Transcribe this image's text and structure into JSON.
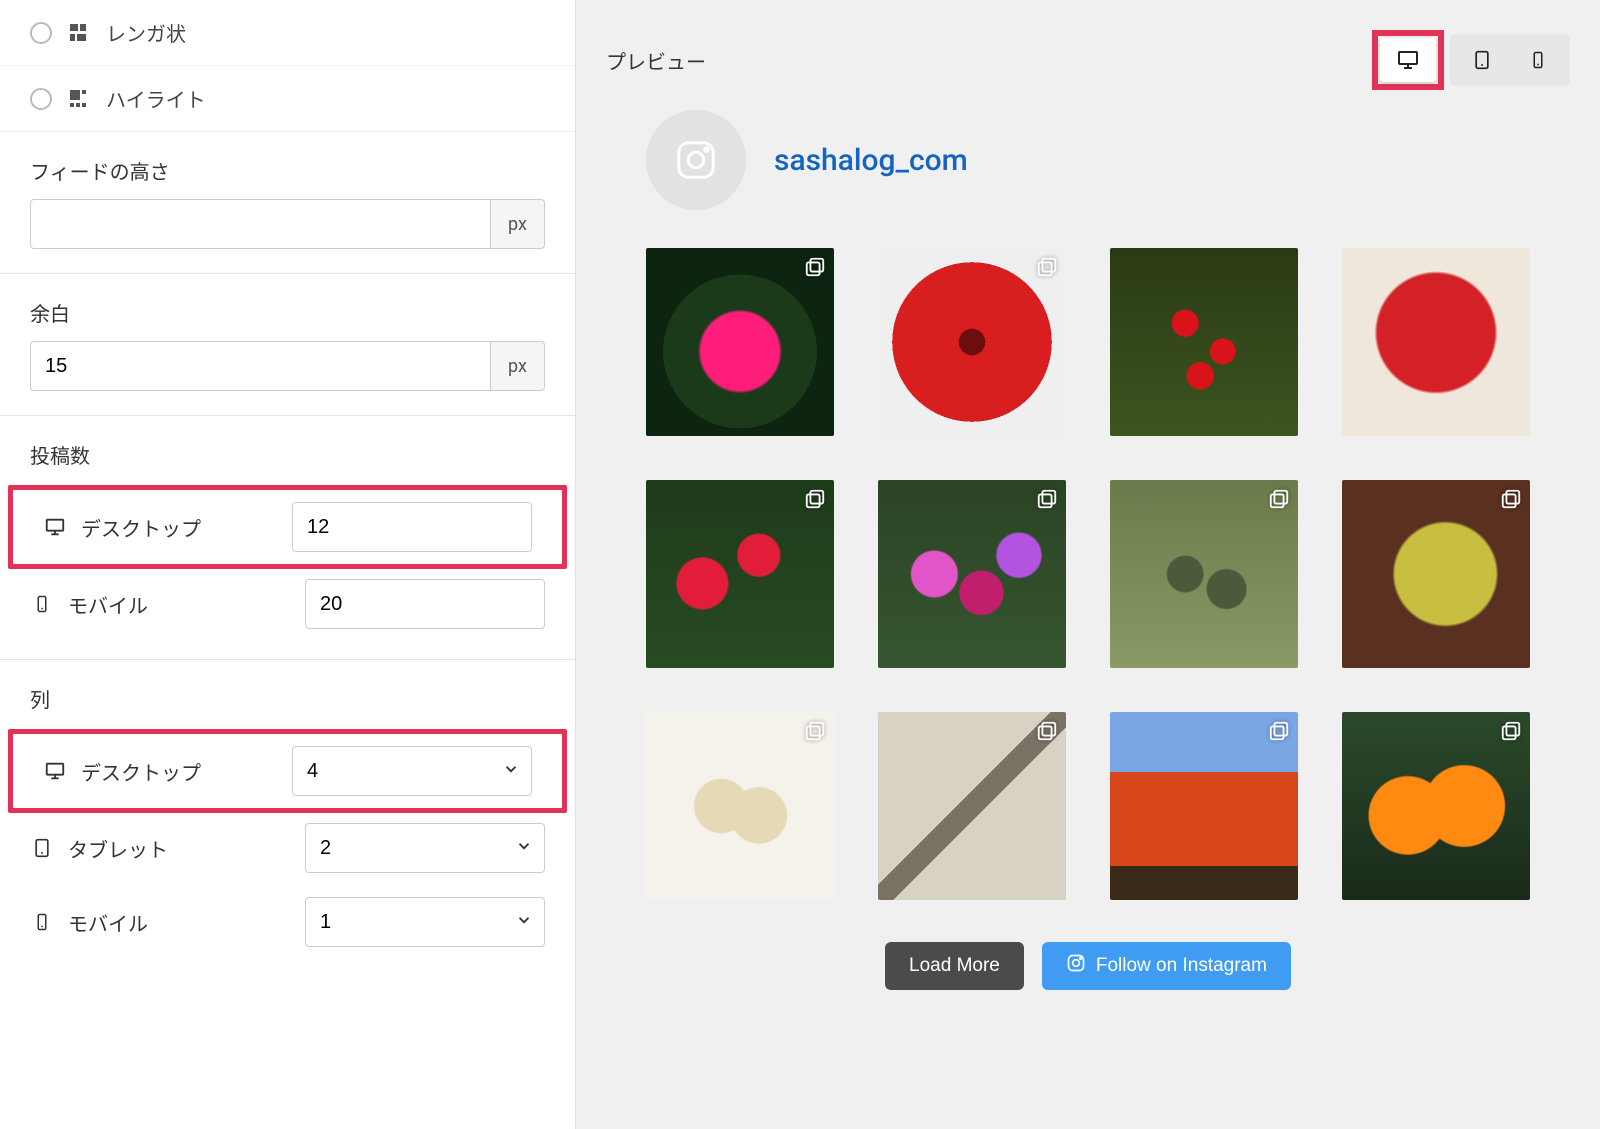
{
  "sidebar": {
    "layout_options": [
      {
        "label": "レンガ状"
      },
      {
        "label": "ハイライト"
      }
    ],
    "feed_height": {
      "label": "フィードの高さ",
      "value": "",
      "unit": "px"
    },
    "padding": {
      "label": "余白",
      "value": "15",
      "unit": "px"
    },
    "posts": {
      "label": "投稿数",
      "desktop_label": "デスクトップ",
      "desktop_value": "12",
      "mobile_label": "モバイル",
      "mobile_value": "20"
    },
    "columns": {
      "label": "列",
      "desktop_label": "デスクトップ",
      "desktop_value": "4",
      "tablet_label": "タブレット",
      "tablet_value": "2",
      "mobile_label": "モバイル",
      "mobile_value": "1"
    }
  },
  "preview": {
    "title": "プレビュー",
    "username": "sashalog_com",
    "load_more": "Load More",
    "follow": "Follow on Instagram"
  }
}
